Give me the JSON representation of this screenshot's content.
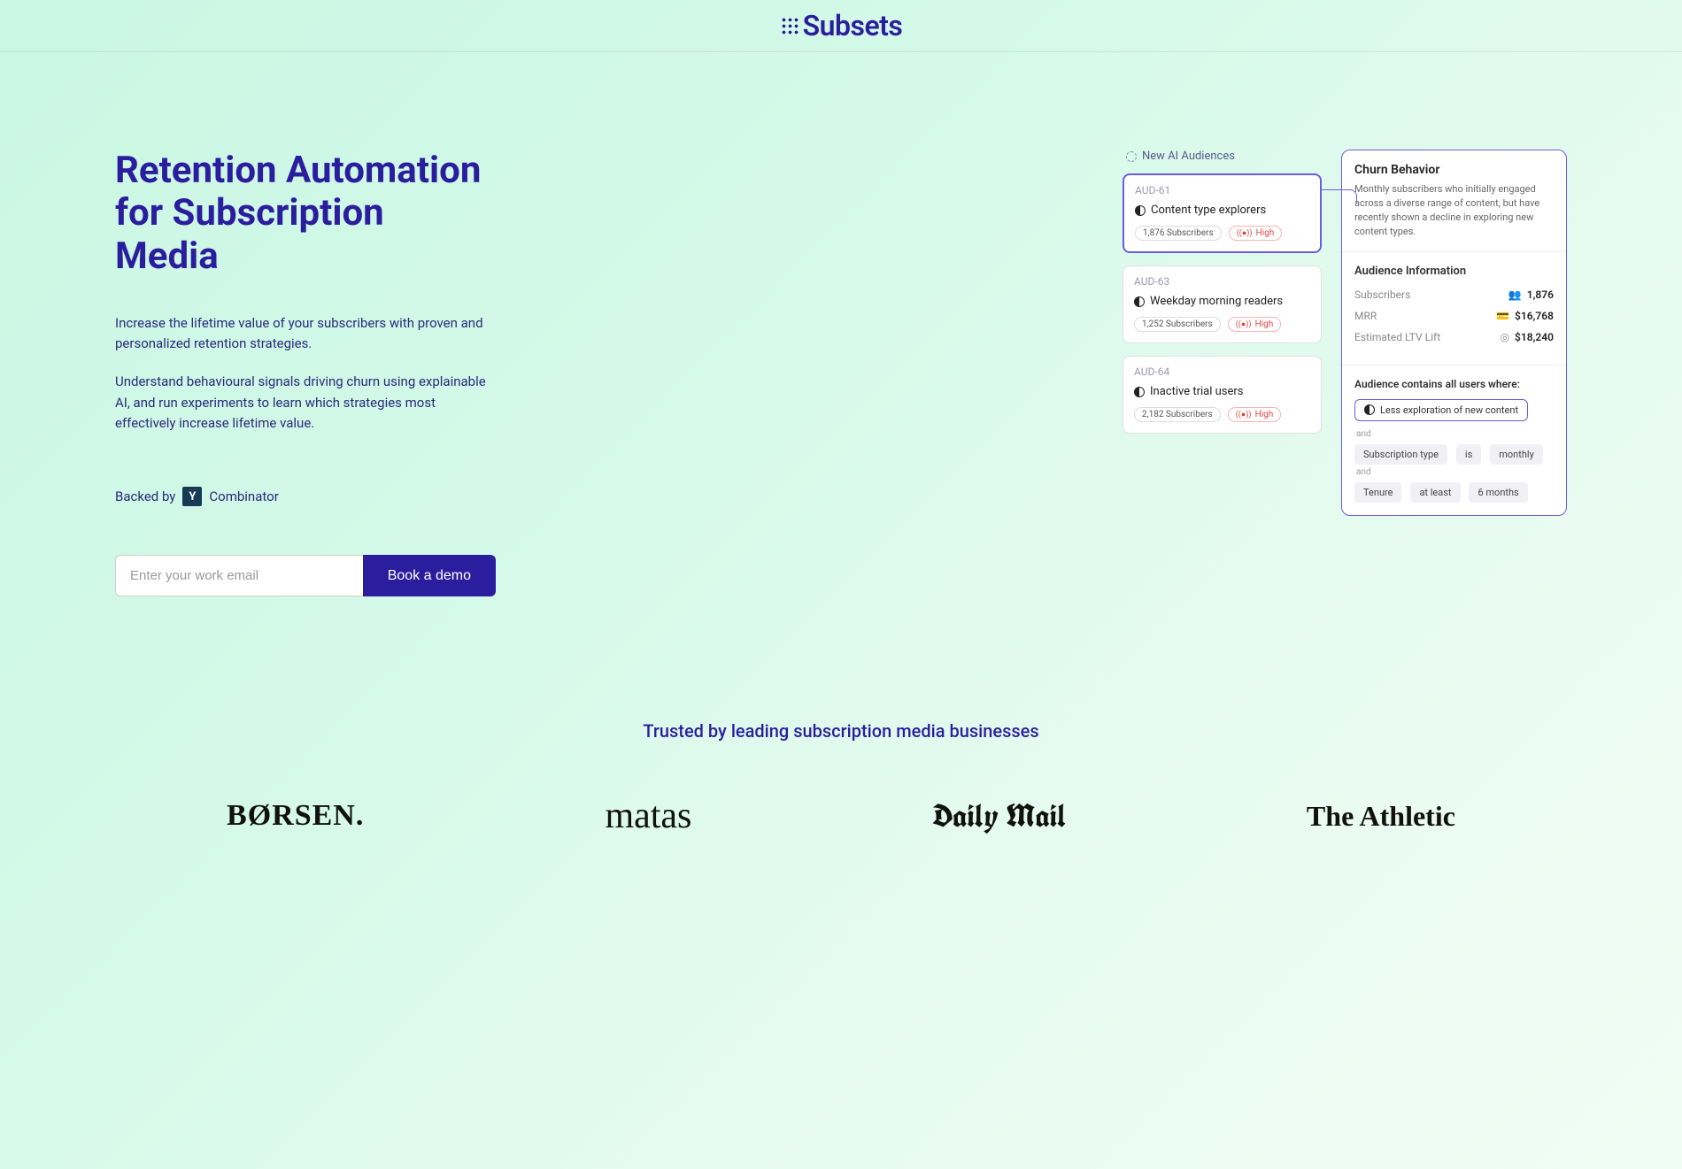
{
  "brand": "Subsets",
  "hero": {
    "title_line1": "Retention Automation",
    "title_line2": "for Subscription Media",
    "para1": "Increase the lifetime value of your subscribers with proven and personalized retention strategies.",
    "para2": "Understand behavioural signals driving churn using explainable AI, and run experiments to learn which strategies most effectively increase lifetime value.",
    "backed_prefix": "Backed by",
    "backed_badge": "Y",
    "backed_name": "Combinator",
    "email_placeholder": "Enter your work email",
    "cta_label": "Book a demo"
  },
  "audiences": {
    "header": "New AI Audiences",
    "items": [
      {
        "id": "AUD-61",
        "title": "Content type explorers",
        "subs": "1,876 Subscribers",
        "risk": "High",
        "active": true
      },
      {
        "id": "AUD-63",
        "title": "Weekday morning readers",
        "subs": "1,252 Subscribers",
        "risk": "High",
        "active": false
      },
      {
        "id": "AUD-64",
        "title": "Inactive trial users",
        "subs": "2,182 Subscribers",
        "risk": "High",
        "active": false
      }
    ]
  },
  "detail": {
    "title": "Churn Behavior",
    "desc": "Monthly subscribers who initially engaged across a diverse range of content, but have recently shown a decline in exploring new content types.",
    "info_header": "Audience Information",
    "rows": [
      {
        "label": "Subscribers",
        "icon": "👥",
        "value": "1,876"
      },
      {
        "label": "MRR",
        "icon": "💳",
        "value": "$16,768"
      },
      {
        "label": "Estimated LTV Lift",
        "icon": "◎",
        "value": "$18,240"
      }
    ],
    "rules_header": "Audience contains all users where:",
    "rule1": "Less exploration of new content",
    "and": "and",
    "chips2": [
      "Subscription type",
      "is",
      "monthly"
    ],
    "chips3": [
      "Tenure",
      "at least",
      "6 months"
    ]
  },
  "trusted": {
    "title": "Trusted by leading subscription media businesses",
    "logos": [
      "BØRSEN.",
      "matas",
      "Daily Mail",
      "The Athletic"
    ]
  }
}
